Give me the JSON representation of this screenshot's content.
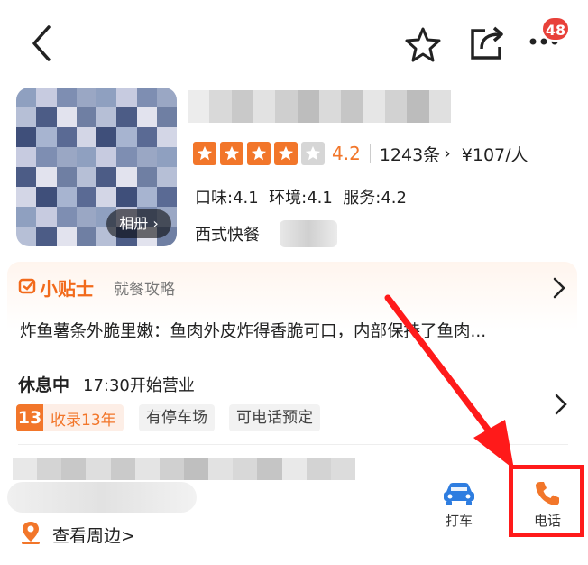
{
  "header": {
    "back_icon": "chevron-left-icon",
    "favorite_icon": "star-outline-icon",
    "share_icon": "share-icon",
    "more_icon": "more-dots-icon",
    "notification_count": "48"
  },
  "shop": {
    "photo_label": "相册",
    "rating": {
      "stars_filled": 4,
      "stars_total": 5,
      "score": "4.2",
      "review_count": "1243条",
      "price": "¥107/人"
    },
    "subscores": "口味:4.1  环境:4.1  服务:4.2",
    "category": "西式快餐"
  },
  "tips": {
    "title": "小贴士",
    "subtitle": "就餐攻略",
    "text": "炸鱼薯条外脆里嫩：鱼肉外皮炸得香脆可口，内部保持了鱼肉..."
  },
  "hours": {
    "status": "休息中",
    "open_text": "17:30开始营业"
  },
  "tags": {
    "year_number": "13",
    "year_text": "收录13年",
    "parking": "有停车场",
    "phone_booking": "可电话预定"
  },
  "nearby": {
    "label": "查看周边",
    "chevron": ">"
  },
  "actions": {
    "taxi": "打车",
    "call": "电话"
  },
  "colors": {
    "accent": "#f2762a",
    "badge": "#e8413a",
    "highlight": "#ff1a1a"
  }
}
